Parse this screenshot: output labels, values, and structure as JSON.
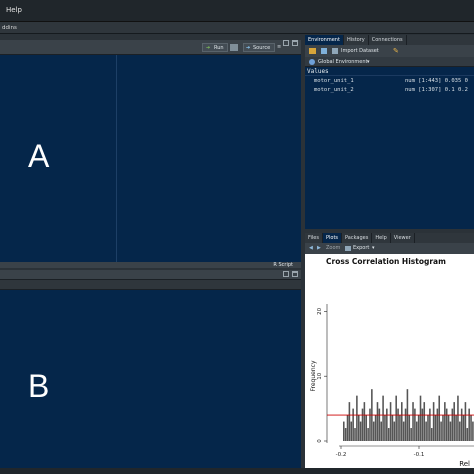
{
  "menu": {
    "help": "Help"
  },
  "toolbar": {
    "addins": "ddins"
  },
  "source": {
    "run_label": "Run",
    "source_label": "Source",
    "footer_label": "R Script",
    "label": "A"
  },
  "console": {
    "label": "B"
  },
  "environment": {
    "tabs": [
      "Environment",
      "History",
      "Connections"
    ],
    "import_label": "Import Dataset",
    "global_label": "Global Environment",
    "section_label": "Values",
    "rows": [
      {
        "name": "motor_unit_1",
        "value": "num [1:443] 0.035 0"
      },
      {
        "name": "motor_unit_2",
        "value": "num [1:307] 0.1 0.2"
      }
    ]
  },
  "plots": {
    "tabs": [
      "Files",
      "Plots",
      "Packages",
      "Help",
      "Viewer"
    ],
    "zoom_label": "Zoom",
    "export_label": "Export"
  },
  "chart_data": {
    "type": "bar",
    "title": "Cross Correlation Histogram",
    "xlabel": "Rel",
    "ylabel": "Frequency",
    "x_ticks": [
      "-0.2",
      "-0.1"
    ],
    "y_ticks": [
      "0",
      "10",
      "20"
    ],
    "ylim": [
      0,
      25
    ],
    "reference_line": 4,
    "colors": {
      "bars": "#555555",
      "reference_line": "#cc0000"
    },
    "values": [
      3,
      2,
      4,
      6,
      3,
      5,
      2,
      7,
      4,
      3,
      5,
      6,
      4,
      2,
      5,
      8,
      3,
      4,
      6,
      5,
      3,
      7,
      4,
      5,
      2,
      6,
      4,
      3,
      7,
      5,
      4,
      6,
      3,
      5,
      8,
      4,
      2,
      6,
      5,
      3,
      4,
      7,
      5,
      6,
      3,
      4,
      5,
      2,
      6,
      4,
      5,
      7,
      3,
      4,
      6,
      5,
      4,
      3,
      5,
      6,
      4,
      7,
      3,
      5,
      4,
      6,
      2,
      5,
      4,
      3
    ]
  }
}
